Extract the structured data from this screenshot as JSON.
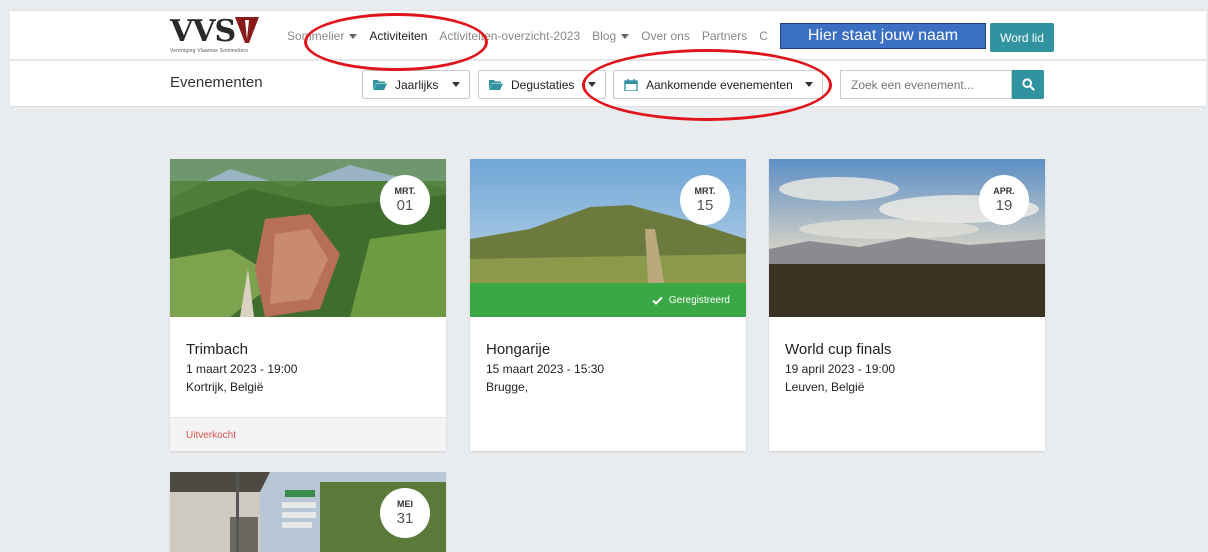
{
  "logo": {
    "text": "VVS",
    "subtitle": "Vereniging Vlaamse Sommeliers"
  },
  "nav": {
    "items": [
      {
        "label": "Sommelier",
        "has_caret": true,
        "active": false
      },
      {
        "label": "Activiteiten",
        "has_caret": false,
        "active": true
      },
      {
        "label": "Activiteiten-overzicht-2023",
        "has_caret": false,
        "active": false
      },
      {
        "label": "Blog",
        "has_caret": true,
        "active": false
      },
      {
        "label": "Over ons",
        "has_caret": false,
        "active": false
      },
      {
        "label": "Partners",
        "has_caret": false,
        "active": false
      },
      {
        "label": "C",
        "has_caret": false,
        "active": false
      }
    ],
    "name_overlay": "Hier staat jouw naam",
    "join_button": "Word lid"
  },
  "subbar": {
    "title": "Evenementen",
    "filters": [
      {
        "label": "Jaarlijks",
        "icon": "folder-open-icon"
      },
      {
        "label": "Degustaties",
        "icon": "folder-open-icon"
      },
      {
        "label": "Aankomende evenementen",
        "icon": "calendar-icon"
      }
    ],
    "search_placeholder": "Zoek een evenement...",
    "search_icon": "search-icon"
  },
  "events": [
    {
      "month": "MRT.",
      "day": "01",
      "title": "Trimbach",
      "datetime": "1 maart 2023 - 19:00",
      "location": "Kortrijk, België",
      "footer": "Uitverkocht",
      "registered": ""
    },
    {
      "month": "MRT.",
      "day": "15",
      "title": "Hongarije",
      "datetime": "15 maart 2023 - 15:30",
      "location": "Brugge,",
      "footer": "",
      "registered": "Geregistreerd"
    },
    {
      "month": "APR.",
      "day": "19",
      "title": "World cup finals",
      "datetime": "19 april 2023 - 19:00",
      "location": "Leuven, België",
      "footer": "",
      "registered": ""
    },
    {
      "month": "MEI",
      "day": "31",
      "title": "",
      "datetime": "",
      "location": "",
      "footer": "",
      "registered": ""
    }
  ],
  "colors": {
    "accent": "#31939f",
    "registered": "#3aa845",
    "soldout": "#d9534f",
    "annotation": "#e0141b",
    "name_box": "#3b6fc3"
  }
}
